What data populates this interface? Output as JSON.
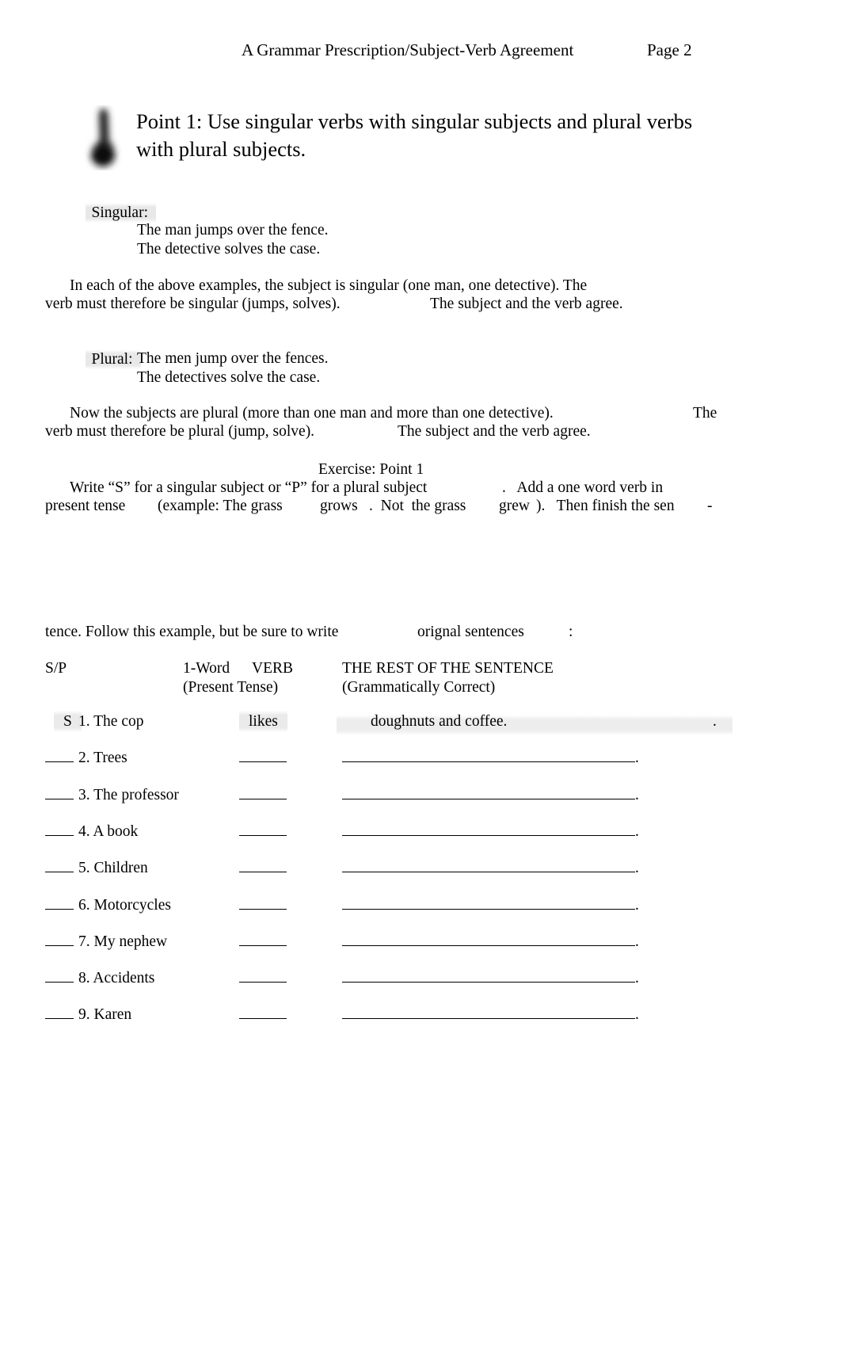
{
  "header": {
    "title": "A Grammar Prescription/Subject-Verb Agreement",
    "page_label": "Page 2"
  },
  "point": {
    "icon": "pen-blob-icon",
    "heading": "Point 1: Use singular verbs with singular subjects  and plural verbs with plural subjects."
  },
  "singular": {
    "label": "Singular:",
    "examples": [
      "The man jumps over the fence.",
      "The detective solves the case."
    ],
    "explanation_line1": "In each of the above examples, the subject is singular (one man, one detective). The",
    "explanation_line2a": "verb must therefore be singular (jumps, solves).",
    "explanation_line2b": "The subject and the verb agree."
  },
  "plural": {
    "label": "Plural:",
    "examples": [
      "The men jump over the fences.",
      "The detectives solve the case."
    ],
    "explanation_line1a": "Now the subjects are plural (more than one man and more than one detective).",
    "explanation_line1b": "The",
    "explanation_line2a": "verb must therefore be plural (jump, solve).",
    "explanation_line2b": "The subject and the verb agree."
  },
  "exercise": {
    "title": "Exercise: Point 1",
    "instructions": {
      "line1a": "Write “S” for a singular subject or “P” for a plural subject",
      "line1b": ".   Add a one word verb in",
      "line2a": "present tense",
      "line2b": "(example: The grass",
      "line2c": "grows",
      "line2d": ".  Not  the grass",
      "line2e": "grew",
      "line2f": ").   Then finish the sen",
      "line2g": "-",
      "line3a": "tence. Follow this example, but be sure to write",
      "line3b": "orignal sentences",
      "line3c": ":"
    },
    "columns": {
      "sp": "S/P",
      "verb_line1_a": "1-Word",
      "verb_line1_b": "VERB",
      "verb_line2": "(Present Tense)",
      "rest_line1": "THE REST OF THE SENTENCE",
      "rest_line2": "(Grammatically Correct)"
    },
    "rows": [
      {
        "sp": "S",
        "subject": "1. The cop",
        "verb": "likes",
        "rest": "doughnuts and coffee.",
        "is_example": true,
        "trailing_period": "."
      },
      {
        "sp": "____",
        "subject": "2. Trees",
        "verb": "",
        "rest": "",
        "is_example": false,
        "trailing_period": "."
      },
      {
        "sp": "____",
        "subject": "3. The professor",
        "verb": "",
        "rest": "",
        "is_example": false,
        "trailing_period": "."
      },
      {
        "sp": "____",
        "subject": "4. A book",
        "verb": "",
        "rest": "",
        "is_example": false,
        "trailing_period": "."
      },
      {
        "sp": "____",
        "subject": "5. Children",
        "verb": "",
        "rest": "",
        "is_example": false,
        "trailing_period": "."
      },
      {
        "sp": "____",
        "subject": "6. Motorcycles",
        "verb": "",
        "rest": "",
        "is_example": false,
        "trailing_period": "."
      },
      {
        "sp": "____",
        "subject": "7. My nephew",
        "verb": "",
        "rest": "",
        "is_example": false,
        "trailing_period": "."
      },
      {
        "sp": "____",
        "subject": "8. Accidents",
        "verb": "",
        "rest": "",
        "is_example": false,
        "trailing_period": "."
      },
      {
        "sp": "____",
        "subject": "9. Karen",
        "verb": "",
        "rest": "",
        "is_example": false,
        "trailing_period": "."
      }
    ]
  }
}
